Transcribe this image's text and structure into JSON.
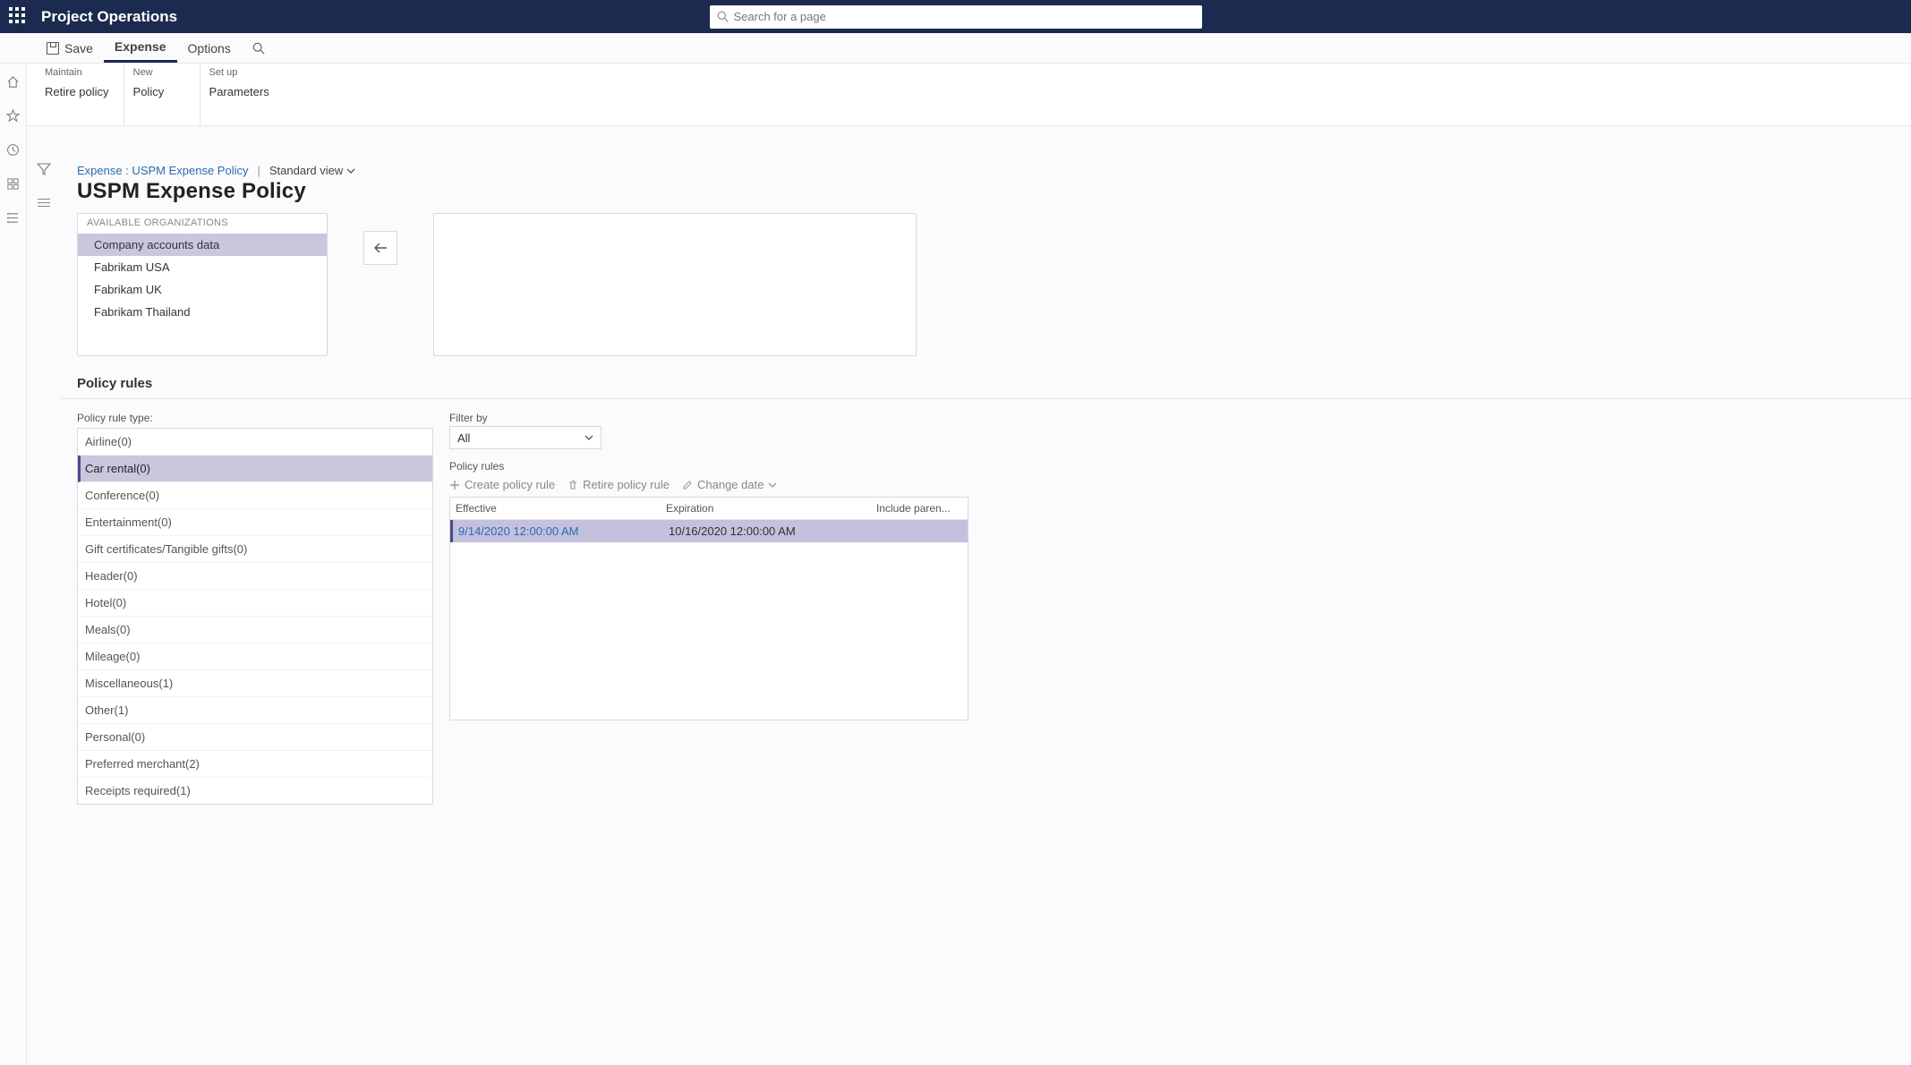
{
  "brand": "Project Operations",
  "search_placeholder": "Search for a page",
  "actionbar": {
    "save": "Save",
    "expense": "Expense",
    "options": "Options"
  },
  "ribbon": {
    "maintain": {
      "label": "Maintain",
      "retire": "Retire policy"
    },
    "new": {
      "label": "New",
      "policy": "Policy"
    },
    "setup": {
      "label": "Set up",
      "parameters": "Parameters"
    }
  },
  "breadcrumb": {
    "link": "Expense : USPM Expense Policy",
    "view": "Standard view"
  },
  "page_title": "USPM Expense Policy",
  "orgs_header": "AVAILABLE ORGANIZATIONS",
  "orgs": [
    {
      "label": "Company accounts data",
      "selected": true
    },
    {
      "label": "Fabrikam USA",
      "selected": false
    },
    {
      "label": "Fabrikam UK",
      "selected": false
    },
    {
      "label": "Fabrikam Thailand",
      "selected": false
    }
  ],
  "policy_rules_section": "Policy rules",
  "policy_rule_type_label": "Policy rule type:",
  "rule_types": [
    {
      "label": "Airline(0)",
      "selected": false
    },
    {
      "label": "Car rental(0)",
      "selected": true
    },
    {
      "label": "Conference(0)",
      "selected": false
    },
    {
      "label": "Entertainment(0)",
      "selected": false
    },
    {
      "label": "Gift certificates/Tangible gifts(0)",
      "selected": false
    },
    {
      "label": "Header(0)",
      "selected": false
    },
    {
      "label": "Hotel(0)",
      "selected": false
    },
    {
      "label": "Meals(0)",
      "selected": false
    },
    {
      "label": "Mileage(0)",
      "selected": false
    },
    {
      "label": "Miscellaneous(1)",
      "selected": false
    },
    {
      "label": "Other(1)",
      "selected": false
    },
    {
      "label": "Personal(0)",
      "selected": false
    },
    {
      "label": "Preferred merchant(2)",
      "selected": false
    },
    {
      "label": "Receipts required(1)",
      "selected": false
    }
  ],
  "filter_by_label": "Filter by",
  "filter_by_value": "All",
  "policy_rules_label": "Policy rules",
  "toolstrip": {
    "create": "Create policy rule",
    "retire": "Retire policy rule",
    "change_date": "Change date"
  },
  "grid": {
    "headers": {
      "effective": "Effective",
      "expiration": "Expiration",
      "include": "Include paren..."
    },
    "rows": [
      {
        "effective": "9/14/2020 12:00:00 AM",
        "expiration": "10/16/2020 12:00:00 AM",
        "include": ""
      }
    ]
  }
}
